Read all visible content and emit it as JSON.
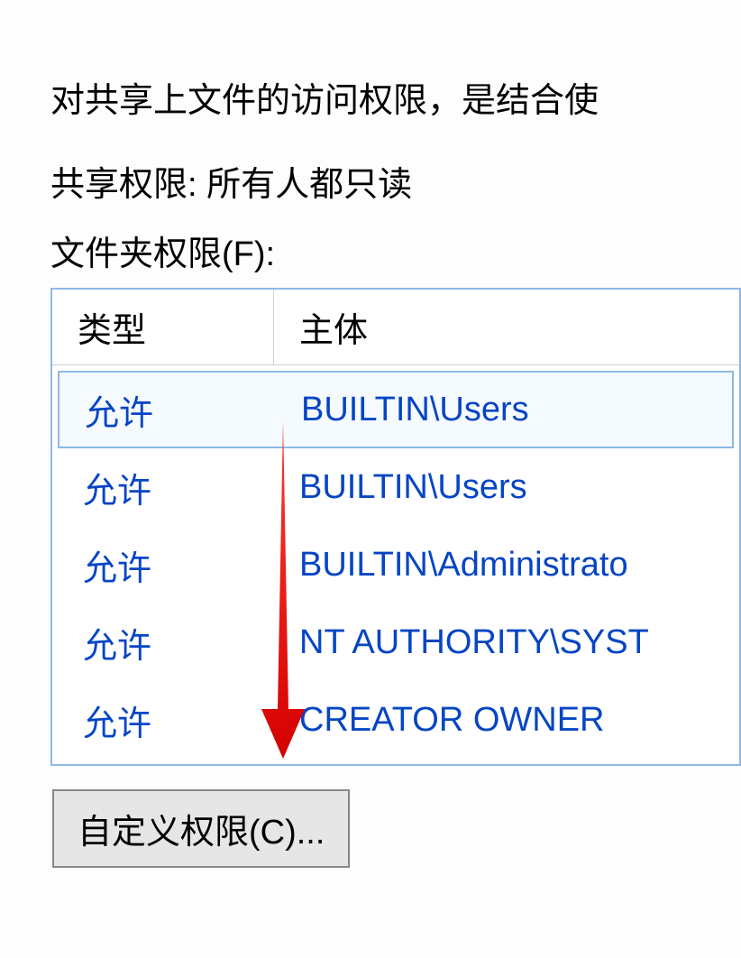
{
  "description": "对共享上文件的访问权限，是结合使",
  "share_permission_label": "共享权限: 所有人都只读",
  "folder_permission_label": "文件夹权限(F):",
  "table": {
    "headers": {
      "type": "类型",
      "principal": "主体"
    },
    "rows": [
      {
        "type": "允许",
        "principal": "BUILTIN\\Users",
        "selected": true
      },
      {
        "type": "允许",
        "principal": "BUILTIN\\Users",
        "selected": false
      },
      {
        "type": "允许",
        "principal": "BUILTIN\\Administrato",
        "selected": false
      },
      {
        "type": "允许",
        "principal": "NT AUTHORITY\\SYST",
        "selected": false
      },
      {
        "type": "允许",
        "principal": "CREATOR OWNER",
        "selected": false
      }
    ]
  },
  "custom_button_label": "自定义权限(C)..."
}
